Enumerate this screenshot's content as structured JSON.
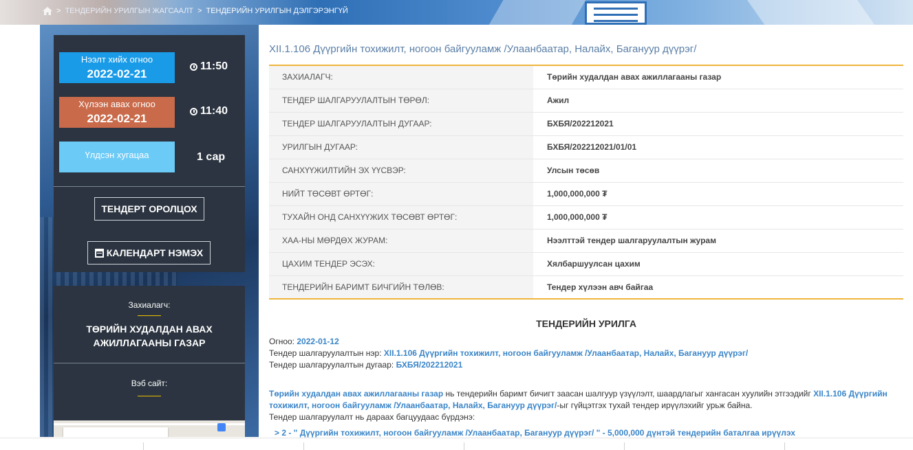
{
  "breadcrumb": {
    "item1": "ТЕНДЕРИЙН УРИЛГЫН ЖАГСААЛТ",
    "item2": "ТЕНДЕРИЙН УРИЛГЫН ДЭЛГЭРЭНГҮЙ"
  },
  "sidebar": {
    "open_label": "Нээлт хийх огноо",
    "open_date": "2022-02-21",
    "open_time": "11:50",
    "receive_label": "Хүлээн авах огноо",
    "receive_date": "2022-02-21",
    "receive_time": "11:40",
    "duration_label": "Үлдсэн хугацаа",
    "duration_value": "1 сар",
    "participate_button": "ТЕНДЕРТ ОРОЛЦОХ",
    "calendar_button": "КАЛЕНДАРТ НЭМЭХ",
    "customer_caption": "Захиалагч:",
    "customer_name": "ТӨРИЙН ХУДАЛДАН АВАХ АЖИЛЛАГААНЫ ГАЗАР",
    "website_caption": "Вэб сайт:",
    "colors": {
      "open": "#1a9be8",
      "receive": "#c96a4a",
      "duration": "#6ccaf6"
    }
  },
  "main": {
    "title": "XII.1.106 Дүүргийн тохижилт, ногоон байгууламж /Улаанбаатар, Налайх, Багануур дүүрэг/",
    "rows": [
      {
        "k": "Захиалагч:",
        "v": "Төрийн худалдан авах ажиллагааны газар"
      },
      {
        "k": "Тендер шалгаруулалтын төрөл:",
        "v": "Ажил"
      },
      {
        "k": "Тендер шалгаруулалтын дугаар:",
        "v": "БХБЯ/202212021"
      },
      {
        "k": "Урилгын дугаар:",
        "v": "БХБЯ/202212021/01/01"
      },
      {
        "k": "Санхүүжилтийн эх үүсвэр:",
        "v": "Улсын төсөв"
      },
      {
        "k": "Нийт төсөвт өртөг:",
        "v": "1,000,000,000 ₮"
      },
      {
        "k": "Тухайн онд санхүүжих төсөвт өртөг:",
        "v": "1,000,000,000 ₮"
      },
      {
        "k": "ХАА-ны мөрдөх журам:",
        "v": "Нээлттэй тендер шалгаруулалтын журам"
      },
      {
        "k": "Цахим тендер эсэх:",
        "v": "Хялбаршуулсан цахим"
      },
      {
        "k": "Тендерийн баримт бичгийн төлөв:",
        "v": "Тендер хүлээн авч байгаа"
      }
    ],
    "notice_title": "ТЕНДЕРИЙН УРИЛГА",
    "date_label": "Огноо:",
    "date_value": "2022-01-12",
    "name_label": "Тендер шалгаруулалтын нэр:",
    "name_value": "XII.1.106 Дүүргийн тохижилт, ногоон байгууламж /Улаанбаатар, Налайх, Багануур дүүрэг/",
    "number_label": "Тендер шалгаруулалтын дугаар:",
    "number_value": "БХБЯ/202212021",
    "para_link1": "Төрийн худалдан авах ажиллагааны газар",
    "para_text1": " нь тендерийн баримт бичигт заасан шалгуур үзүүлэлт, шаардлагыг хангасан хуулийн этгээдийг ",
    "para_link2": "XII.1.106 Дүүргийн тохижилт, ногоон байгууламж /Улаанбаатар, Налайх, Багануур дүүрэг/",
    "para_text2": "-ыг гүйцэтгэх тухай тендер ирүүлэхийг урьж байна.",
    "para_text3": "Тендер шалгаруулалт нь дараах багцуудаас бүрдэнэ:",
    "package_item": "> 2 - \" Дүүргийн тохижилт, ногоон байгууламж /Улаанбаатар, Багануур дүүрэг/ \" - 5,000,000 дүнтэй тендерийн баталгаа ирүүлэх"
  }
}
